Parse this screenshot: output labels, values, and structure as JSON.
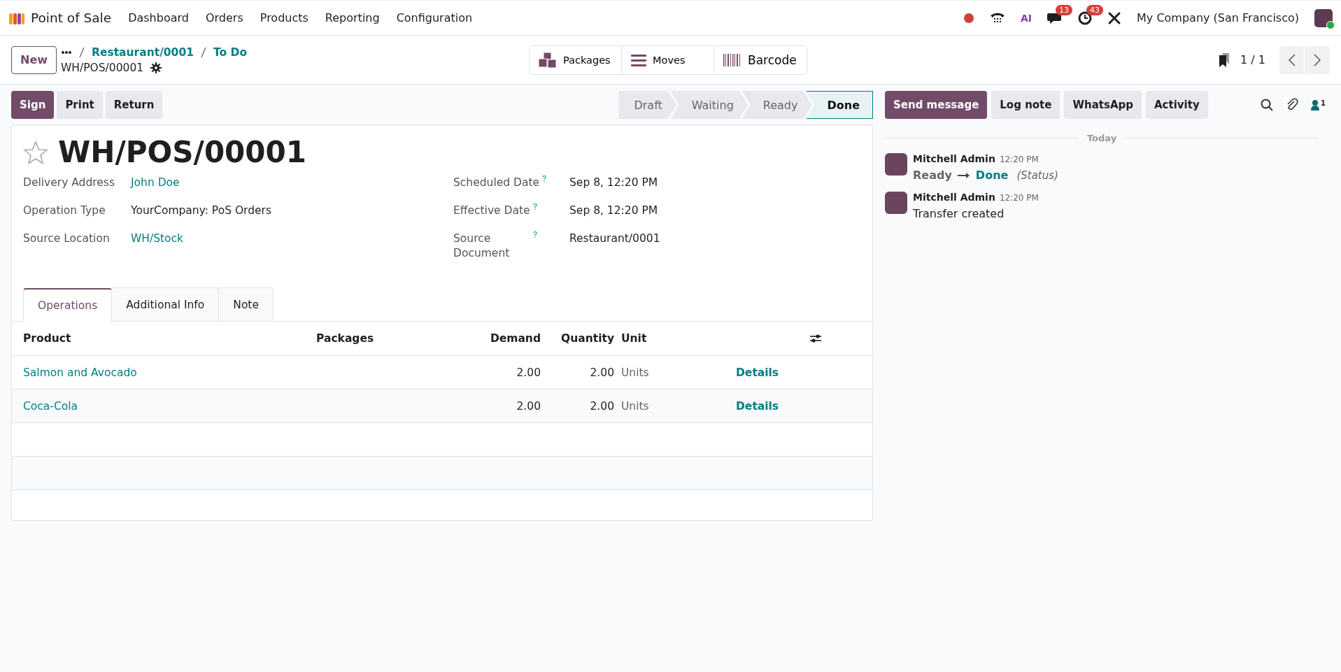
{
  "app": {
    "name": "Point of Sale"
  },
  "menu": [
    "Dashboard",
    "Orders",
    "Products",
    "Reporting",
    "Configuration"
  ],
  "systray": {
    "ai_label": "AI",
    "messages_count": "13",
    "activities_count": "43",
    "company": "My Company (San Francisco)"
  },
  "new_button": "New",
  "breadcrumbs": [
    "Restaurant/0001",
    "To Do"
  ],
  "current_record": "WH/POS/00001",
  "smart_buttons": [
    {
      "label": "Packages",
      "kind": "packages"
    },
    {
      "label": "Moves",
      "kind": "moves"
    },
    {
      "label": "Barcode",
      "kind": "barcode"
    }
  ],
  "pager": "1 / 1",
  "action_buttons": [
    {
      "label": "Sign",
      "primary": true
    },
    {
      "label": "Print",
      "primary": false
    },
    {
      "label": "Return",
      "primary": false
    }
  ],
  "statusbar": [
    {
      "label": "Draft",
      "selected": false
    },
    {
      "label": "Waiting",
      "selected": false
    },
    {
      "label": "Ready",
      "selected": false
    },
    {
      "label": "Done",
      "selected": true
    }
  ],
  "record": {
    "starred": false,
    "name": "WH/POS/00001",
    "fields_left": [
      {
        "label": "Delivery Address",
        "value": "John Doe",
        "link": true,
        "help": false
      },
      {
        "label": "Operation Type",
        "value": "YourCompany: PoS Orders",
        "link": false,
        "help": false
      },
      {
        "label": "Source Location",
        "value": "WH/Stock",
        "link": true,
        "help": false
      }
    ],
    "fields_right": [
      {
        "label": "Scheduled Date",
        "value": "Sep 8, 12:20 PM",
        "link": false,
        "help": true
      },
      {
        "label": "Effective Date",
        "value": "Sep 8, 12:20 PM",
        "link": false,
        "help": true
      },
      {
        "label": "Source Document",
        "value": "Restaurant/0001",
        "link": false,
        "help": true
      }
    ]
  },
  "tabs": [
    {
      "label": "Operations",
      "selected": true
    },
    {
      "label": "Additional Info",
      "selected": false
    },
    {
      "label": "Note",
      "selected": false
    }
  ],
  "table": {
    "columns": [
      "Product",
      "Packages",
      "Demand",
      "Quantity",
      "Unit"
    ],
    "rows": [
      {
        "product": "Salmon and Avocado",
        "demand": "2.00",
        "quantity": "2.00",
        "unit": "Units",
        "action": "Details"
      },
      {
        "product": "Coca-Cola",
        "demand": "2.00",
        "quantity": "2.00",
        "unit": "Units",
        "action": "Details"
      }
    ]
  },
  "chatter": {
    "buttons": [
      {
        "label": "Send message",
        "primary": true
      },
      {
        "label": "Log note",
        "primary": false
      },
      {
        "label": "WhatsApp",
        "primary": false
      },
      {
        "label": "Activity",
        "primary": false
      }
    ],
    "followers_count": "1",
    "date_separator": "Today",
    "messages": [
      {
        "kind": "tracking",
        "author": "Mitchell Admin",
        "time": "12:20 PM",
        "old_value": "Ready",
        "new_value": "Done",
        "field": "(Status)"
      },
      {
        "kind": "text",
        "author": "Mitchell Admin",
        "time": "12:20 PM",
        "body": "Transfer created"
      }
    ]
  }
}
